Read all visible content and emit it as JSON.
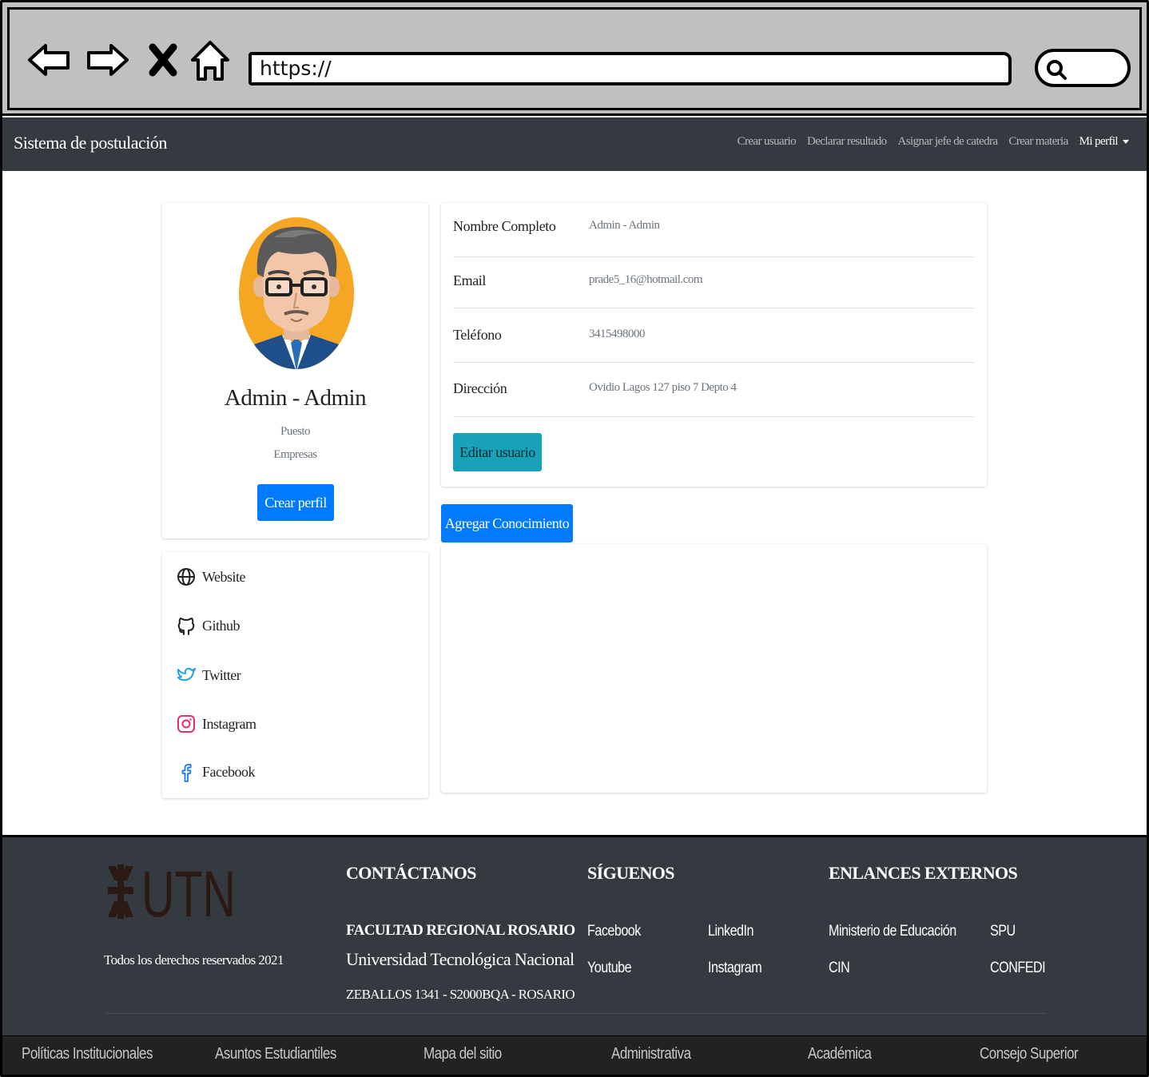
{
  "browser": {
    "url": "https://",
    "icons": [
      "back-arrow-icon",
      "forward-arrow-icon",
      "close-x-icon",
      "home-icon",
      "search-icon"
    ]
  },
  "navbar": {
    "brand": "Sistema de postulación",
    "links": [
      "Crear usuario",
      "Declarar resultado",
      "Asignar jefe de catedra",
      "Crear materia"
    ],
    "profile_menu": "Mi perfil"
  },
  "profile": {
    "name": "Admin - Admin",
    "position": "Puesto",
    "company": "Empresas",
    "create_button": "Crear perfil"
  },
  "social": {
    "items": [
      {
        "label": "Website",
        "icon": "globe-icon"
      },
      {
        "label": "Github",
        "icon": "github-icon"
      },
      {
        "label": "Twitter",
        "icon": "twitter-icon"
      },
      {
        "label": "Instagram",
        "icon": "instagram-icon"
      },
      {
        "label": "Facebook",
        "icon": "facebook-icon"
      }
    ]
  },
  "details": {
    "rows": [
      {
        "label": "Nombre Completo",
        "value": "Admin - Admin"
      },
      {
        "label": "Email",
        "value": "prade5_16@hotmail.com"
      },
      {
        "label": "Teléfono",
        "value": "3415498000"
      },
      {
        "label": "Dirección",
        "value": "Ovidio Lagos 127 piso 7 Depto 4"
      }
    ],
    "edit_button": "Editar usuario"
  },
  "knowledge": {
    "add_button": "Agregar Conocimiento"
  },
  "footer": {
    "logo_text": "UTN",
    "rights": "Todos los derechos reservados 2021",
    "contact": {
      "heading": "CONTÁCTANOS",
      "faculty": "FACULTAD REGIONAL ROSARIO",
      "university": "Universidad Tecnológica Nacional",
      "address": "ZEBALLOS 1341 - S2000BQA - ROSARIO"
    },
    "follow": {
      "heading": "SÍGUENOS",
      "links": [
        "Facebook",
        "LinkedIn",
        "Youtube",
        "Instagram"
      ]
    },
    "external": {
      "heading": "ENLANCES EXTERNOS",
      "links": [
        "Ministerio de Educación",
        "SPU",
        "CIN",
        "CONFEDI"
      ]
    },
    "bottom_links": [
      "Políticas Institucionales",
      "Asuntos Estudiantiles",
      "Mapa del sitio",
      "Administrativa",
      "Académica",
      "Consejo Superior"
    ]
  },
  "colors": {
    "navbar_bg": "#343a40",
    "primary": "#007bff",
    "info": "#17a2b8",
    "chrome_bg": "#c0c0c0",
    "bottom_bar_bg": "#222222"
  }
}
